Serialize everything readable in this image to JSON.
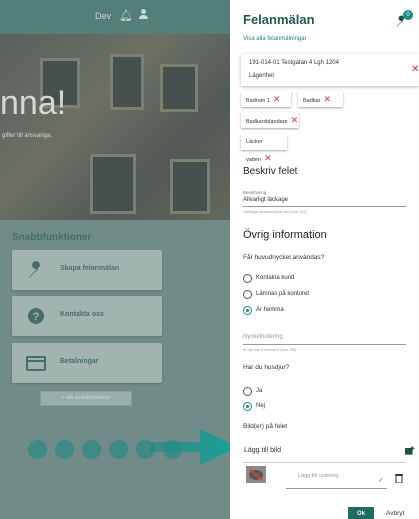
{
  "background_app": {
    "topbar": {
      "env_label": "Dev"
    },
    "hero": {
      "headline": "nna!",
      "subtext": "gifter till ansvariga,"
    },
    "quick_actions": {
      "title": "Snabbfunktioner",
      "items": [
        {
          "label": "Skapa felanmälan",
          "icon": "wrench-icon"
        },
        {
          "label": "Kontakta oss",
          "icon": "question-icon"
        },
        {
          "label": "Betalningar",
          "icon": "card-icon"
        }
      ],
      "more_label": "+ alla snabbfunktioner"
    }
  },
  "panel": {
    "title": "Felanmälan",
    "badge_count": "0",
    "view_all_link": "Visa alla felanmälningar",
    "address": {
      "line1": "191-014-01 Testgatan 4 Lgh 1204",
      "line2": "Lägenhet"
    },
    "chips": [
      {
        "label": "Badrum 1"
      },
      {
        "label": "Badkar"
      },
      {
        "label": "Badkarsblandare"
      },
      {
        "label": "Läcker vatten"
      }
    ],
    "describe": {
      "heading": "Beskriv felet",
      "field_label": "Beskrivning",
      "field_value": "Allvarligt läckage",
      "hint": "Ytterligare beskrivning av felet (max 512)"
    },
    "other_info": {
      "heading": "Övrig information",
      "key_question": "Får huvudnyckel användas?",
      "key_options": [
        {
          "label": "Kontakta kund",
          "selected": false
        },
        {
          "label": "Lämnas på kontoret",
          "selected": false
        },
        {
          "label": "Är hemma",
          "selected": true
        }
      ],
      "key_note_placeholder": "Nyckelnotering",
      "key_note_hint": "Ex när kan vi komma in (max 256)",
      "pet_question": "Har du husdjur?",
      "pet_options": [
        {
          "label": "Ja",
          "selected": false
        },
        {
          "label": "Nej",
          "selected": true
        }
      ]
    },
    "images": {
      "heading": "Bild(er) på felet",
      "add_label": "Lägg till bild",
      "note_placeholder": "Lägg till notering"
    },
    "actions": {
      "ok": "Ok",
      "cancel": "Avbryt"
    }
  },
  "colors": {
    "accent": "#1b8a82",
    "primary_dark": "#1f5a52",
    "danger": "#d23b3b"
  }
}
